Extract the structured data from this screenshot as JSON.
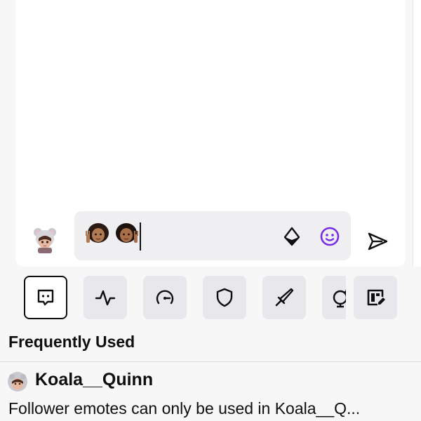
{
  "composer": {
    "user_avatar_icon": "koala-girl-avatar-icon",
    "emotes": [
      "peace-sign-girl-emote",
      "peace-sign-girl-emote"
    ],
    "bits_icon": "bits-diamond-icon",
    "emote_picker_icon": "smiley-face-icon",
    "emote_picker_color": "#772ce8",
    "send_icon": "send-arrow-icon"
  },
  "toolbar": [
    {
      "name": "chat-icon",
      "active": true
    },
    {
      "name": "activity-icon",
      "active": false
    },
    {
      "name": "speedometer-icon",
      "active": false
    },
    {
      "name": "shield-icon",
      "active": false
    },
    {
      "name": "sword-icon",
      "active": false
    },
    {
      "name": "globe-sparkle-icon",
      "active": false
    },
    {
      "name": "edit-board-icon",
      "active": false
    }
  ],
  "picker": {
    "section_title": "Frequently Used",
    "channel_name": "Koala__Quinn",
    "notice": "Follower emotes can only be used in Koala__Q..."
  }
}
